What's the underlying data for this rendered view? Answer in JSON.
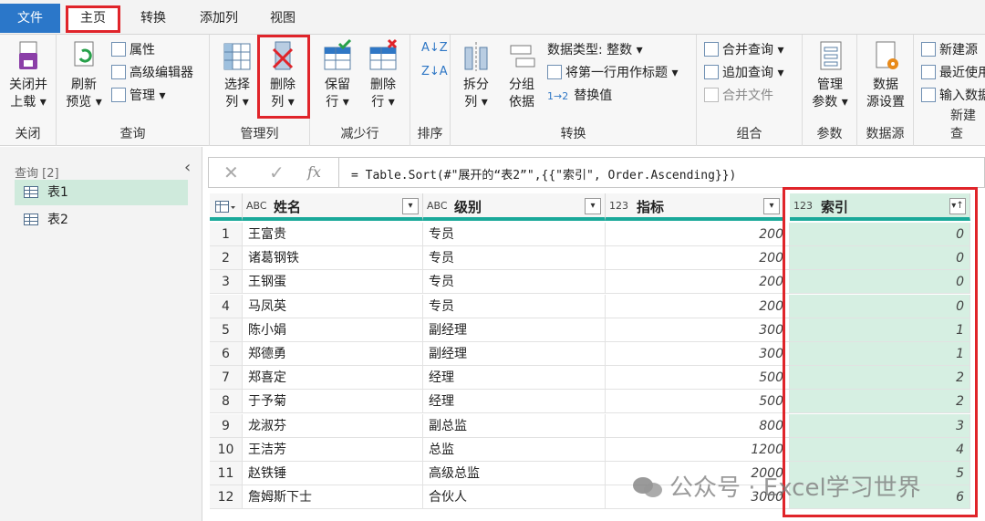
{
  "tabs": [
    "文件",
    "主页",
    "转换",
    "添加列",
    "视图"
  ],
  "ribbon": {
    "close_group": {
      "btn_line1": "关闭并",
      "btn_line2": "上载",
      "label": "关闭"
    },
    "query_group": {
      "refresh_line1": "刷新",
      "refresh_line2": "预览",
      "properties": "属性",
      "advanced_editor": "高级编辑器",
      "manage": "管理",
      "label": "查询"
    },
    "manage_cols_group": {
      "choose_line1": "选择",
      "choose_line2": "列",
      "remove_line1": "删除",
      "remove_line2": "列",
      "label": "管理列"
    },
    "reduce_rows_group": {
      "keep_line1": "保留",
      "keep_line2": "行",
      "remove_line1": "删除",
      "remove_line2": "行",
      "label": "减少行"
    },
    "sort_group": {
      "label": "排序"
    },
    "transform_group": {
      "split_line1": "拆分",
      "split_line2": "列",
      "groupby_line1": "分组",
      "groupby_line2": "依据",
      "datatype": "数据类型: 整数",
      "first_row_header": "将第一行用作标题",
      "replace_values": "替换值",
      "label": "转换"
    },
    "combine_group": {
      "merge_queries": "合并查询",
      "append_queries": "追加查询",
      "combine_files": "合并文件",
      "label": "组合"
    },
    "params_group": {
      "line1": "管理",
      "line2": "参数",
      "label": "参数"
    },
    "datasource_group": {
      "line1": "数据",
      "line2": "源设置",
      "label": "数据源"
    },
    "newquery_group": {
      "new_source": "新建源",
      "recent_sources": "最近使用",
      "enter_data": "输入数据",
      "label": "新建查"
    }
  },
  "left_pane": {
    "title": "查询 [2]",
    "queries": [
      "表1",
      "表2"
    ]
  },
  "formula": "= Table.Sort(#\"展开的“表2”\",{{\"索引\", Order.Ascending}})",
  "columns": [
    {
      "type": "ABC",
      "name": "姓名"
    },
    {
      "type": "ABC",
      "name": "级别"
    },
    {
      "type": "123",
      "name": "指标"
    },
    {
      "type": "123",
      "name": "索引"
    }
  ],
  "rows": [
    {
      "n": "1",
      "name": "王富贵",
      "level": "专员",
      "target": "200",
      "idx": "0"
    },
    {
      "n": "2",
      "name": "诸葛钢铁",
      "level": "专员",
      "target": "200",
      "idx": "0"
    },
    {
      "n": "3",
      "name": "王钢蛋",
      "level": "专员",
      "target": "200",
      "idx": "0"
    },
    {
      "n": "4",
      "name": "马凤英",
      "level": "专员",
      "target": "200",
      "idx": "0"
    },
    {
      "n": "5",
      "name": "陈小娟",
      "level": "副经理",
      "target": "300",
      "idx": "1"
    },
    {
      "n": "6",
      "name": "郑德勇",
      "level": "副经理",
      "target": "300",
      "idx": "1"
    },
    {
      "n": "7",
      "name": "郑喜定",
      "level": "经理",
      "target": "500",
      "idx": "2"
    },
    {
      "n": "8",
      "name": "于予菊",
      "level": "经理",
      "target": "500",
      "idx": "2"
    },
    {
      "n": "9",
      "name": "龙淑芬",
      "level": "副总监",
      "target": "800",
      "idx": "3"
    },
    {
      "n": "10",
      "name": "王洁芳",
      "level": "总监",
      "target": "1200",
      "idx": "4"
    },
    {
      "n": "11",
      "name": "赵铁锤",
      "level": "高级总监",
      "target": "2000",
      "idx": "5"
    },
    {
      "n": "12",
      "name": "詹姆斯下士",
      "level": "合伙人",
      "target": "3000",
      "idx": "6"
    }
  ],
  "watermark": "公众号 · Excel学习世界",
  "colors": {
    "accent": "#1aa99a",
    "highlight": "#e0242a",
    "file_tab": "#2b77c9",
    "selected": "#d6efe2"
  }
}
